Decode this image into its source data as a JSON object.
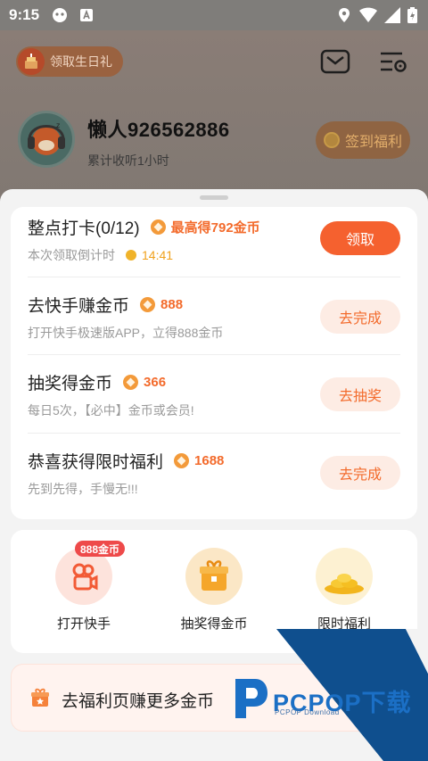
{
  "status_bar": {
    "time": "9:15"
  },
  "header": {
    "birthday_label": "领取生日礼",
    "username": "懒人926562886",
    "listen_time": "累计收听1小时",
    "signin_label": "签到福利"
  },
  "tasks": [
    {
      "title": "整点打卡(0/12)",
      "reward": "最高得792金币",
      "subtitle": "本次领取倒计时",
      "countdown": "14:41",
      "button": "领取"
    },
    {
      "title": "去快手赚金币",
      "reward": "888",
      "subtitle": "打开快手极速版APP，立得888金币",
      "button": "去完成"
    },
    {
      "title": "抽奖得金币",
      "reward": "366",
      "subtitle": "每日5次，【必中】金币或会员!",
      "button": "去抽奖"
    },
    {
      "title": "恭喜获得限时福利",
      "reward": "1688",
      "subtitle": "先到先得，手慢无!!!",
      "button": "去完成"
    }
  ],
  "shortcuts": [
    {
      "label": "打开快手",
      "badge": "888金币"
    },
    {
      "label": "抽奖得金币"
    },
    {
      "label": "限时福利"
    }
  ],
  "banner": {
    "text": "去福利页赚更多金币"
  },
  "watermark": {
    "title": "PCPOP下载",
    "subtitle": "PCPOP Download"
  },
  "colors": {
    "accent": "#f5612f",
    "reward": "#f36b2c",
    "watermark": "#1b6fc5"
  }
}
